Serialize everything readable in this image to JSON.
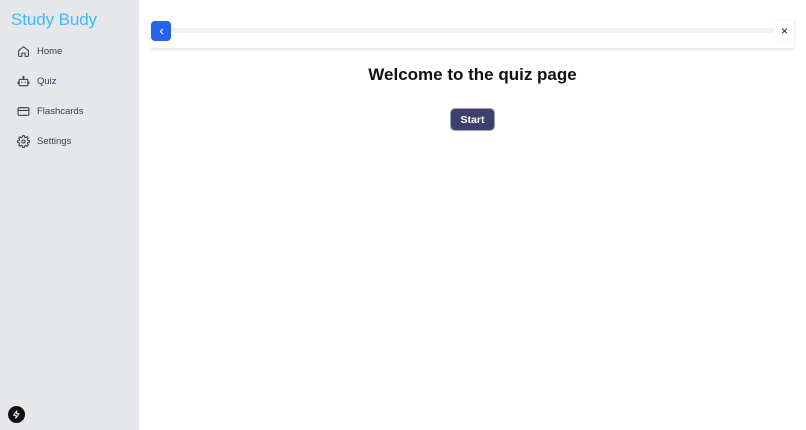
{
  "sidebar": {
    "brand": "Study Budy",
    "items": [
      {
        "label": "Home",
        "icon": "home-icon"
      },
      {
        "label": "Quiz",
        "icon": "robot-icon"
      },
      {
        "label": "Flashcards",
        "icon": "card-icon"
      },
      {
        "label": "Settings",
        "icon": "gear-icon"
      }
    ],
    "footer_icon": "bolt-icon"
  },
  "topbar": {
    "back_icon": "chevron-left-icon",
    "close_label": "×",
    "progress": 0
  },
  "main": {
    "heading": "Welcome to the quiz page",
    "start_label": "Start"
  },
  "colors": {
    "brand": "#38bdf8",
    "sidebar_bg": "#e5e7eb",
    "accent": "#2563eb",
    "start_button": "#3f3f6e"
  }
}
